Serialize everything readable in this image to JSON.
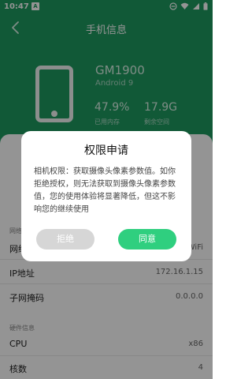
{
  "status_bar": {
    "time": "10:47",
    "badge": "A"
  },
  "header": {
    "title": "手机信息"
  },
  "device": {
    "name": "GM1900",
    "os": "Android 9",
    "stats": [
      {
        "value": "47.9%",
        "label": "已用内存"
      },
      {
        "value": "17.9G",
        "label": "剩余空间"
      }
    ]
  },
  "network": {
    "section_label": "网络",
    "rows": [
      {
        "label": "网络",
        "value": "WiFi"
      },
      {
        "label": "IP地址",
        "value": "172.16.1.15"
      },
      {
        "label": "子网掩码",
        "value": "0.0.0.0"
      }
    ]
  },
  "hardware": {
    "section_label": "硬件信息",
    "rows": [
      {
        "label": "CPU",
        "value": "x86"
      },
      {
        "label": "核数",
        "value": "4"
      }
    ]
  },
  "dialog": {
    "title": "权限申请",
    "message": "相机权限：获取摄像头像素参数值。如你拒绝授权，则无法获取到摄像头像素参数值，您的使用体验将显著降低，但这不影响您的继续使用",
    "deny_label": "拒绝",
    "agree_label": "同意"
  },
  "colors": {
    "header_green": "#1e9a60",
    "agree_green": "#2fcf7f",
    "deny_gray": "#d6d6d6"
  }
}
